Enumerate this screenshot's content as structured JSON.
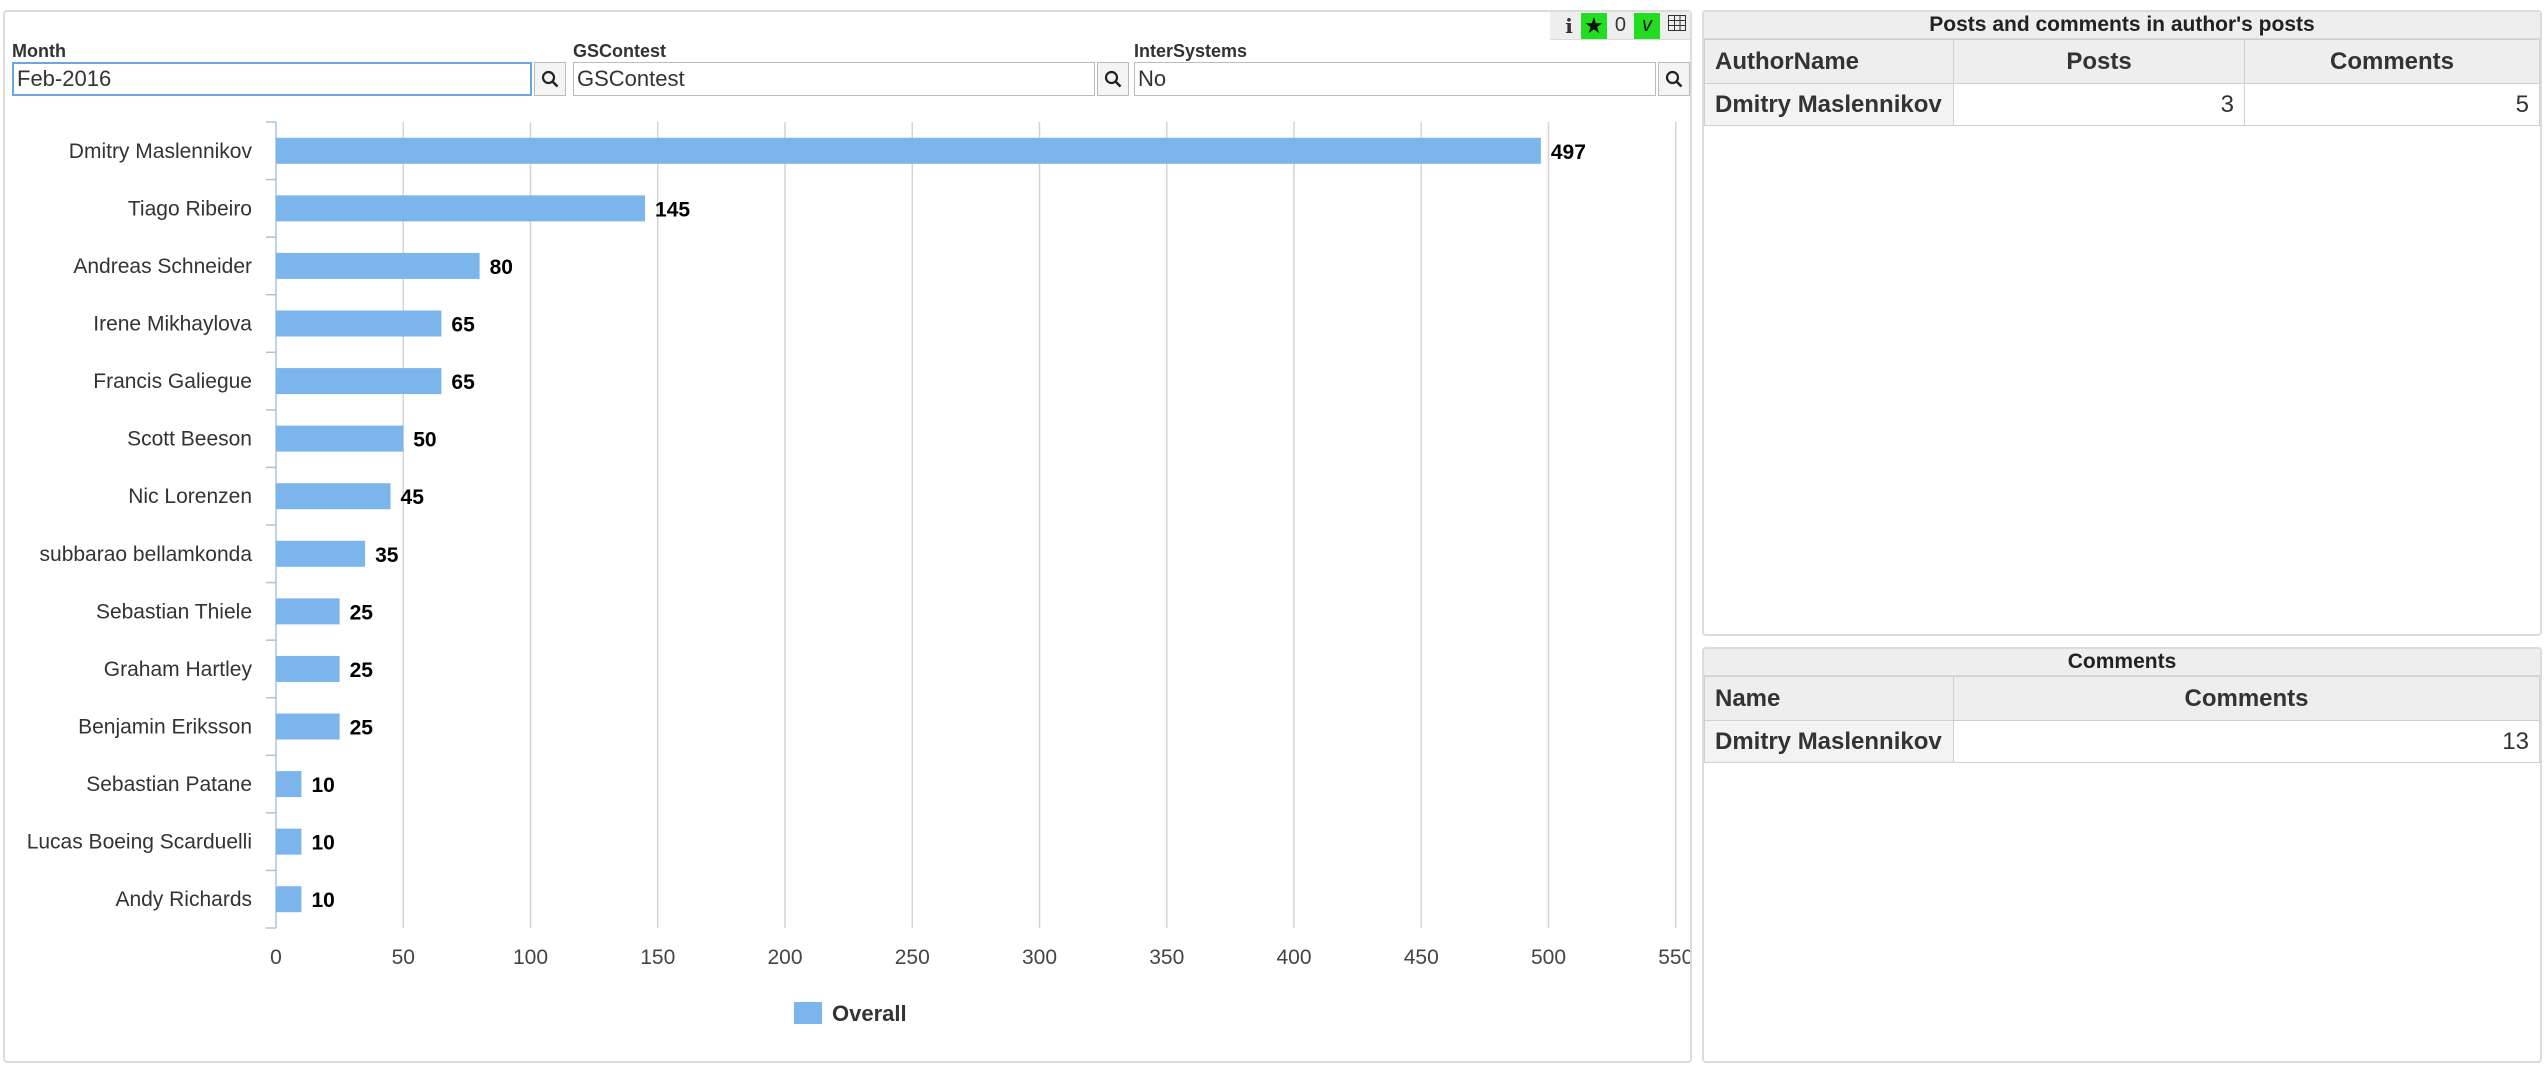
{
  "toolbar": {
    "info_glyph": "i",
    "count": "0",
    "v_label": "v"
  },
  "filters": [
    {
      "label": "Month",
      "value": "Feb-2016"
    },
    {
      "label": "GSContest",
      "value": "GSContest"
    },
    {
      "label": "InterSystems",
      "value": "No"
    }
  ],
  "chart_data": {
    "type": "bar",
    "orientation": "horizontal",
    "categories": [
      "Dmitry Maslennikov",
      "Tiago Ribeiro",
      "Andreas Schneider",
      "Irene Mikhaylova",
      "Francis Galiegue",
      "Scott Beeson",
      "Nic Lorenzen",
      "subbarao bellamkonda",
      "Sebastian Thiele",
      "Graham Hartley",
      "Benjamin Eriksson",
      "Sebastian Patane",
      "Lucas Boeing Scarduelli",
      "Andy Richards"
    ],
    "series": [
      {
        "name": "Overall",
        "values": [
          497,
          145,
          80,
          65,
          65,
          50,
          45,
          35,
          25,
          25,
          25,
          10,
          10,
          10
        ],
        "color": "#7cb5ec"
      }
    ],
    "xticks": [
      0,
      50,
      100,
      150,
      200,
      250,
      300,
      350,
      400,
      450,
      500,
      550
    ],
    "xlim": [
      0,
      550
    ],
    "data_labels": true,
    "grid": true,
    "legend": "bottom-center"
  },
  "posts_table": {
    "title": "Posts and comments in author's posts",
    "columns": [
      "AuthorName",
      "Posts",
      "Comments"
    ],
    "rows": [
      {
        "name": "Dmitry Maslennikov",
        "posts": "3",
        "comments": "5"
      }
    ]
  },
  "comments_table": {
    "title": "Comments",
    "columns": [
      "Name",
      "Comments"
    ],
    "rows": [
      {
        "name": "Dmitry Maslennikov",
        "comments": "13"
      }
    ]
  }
}
